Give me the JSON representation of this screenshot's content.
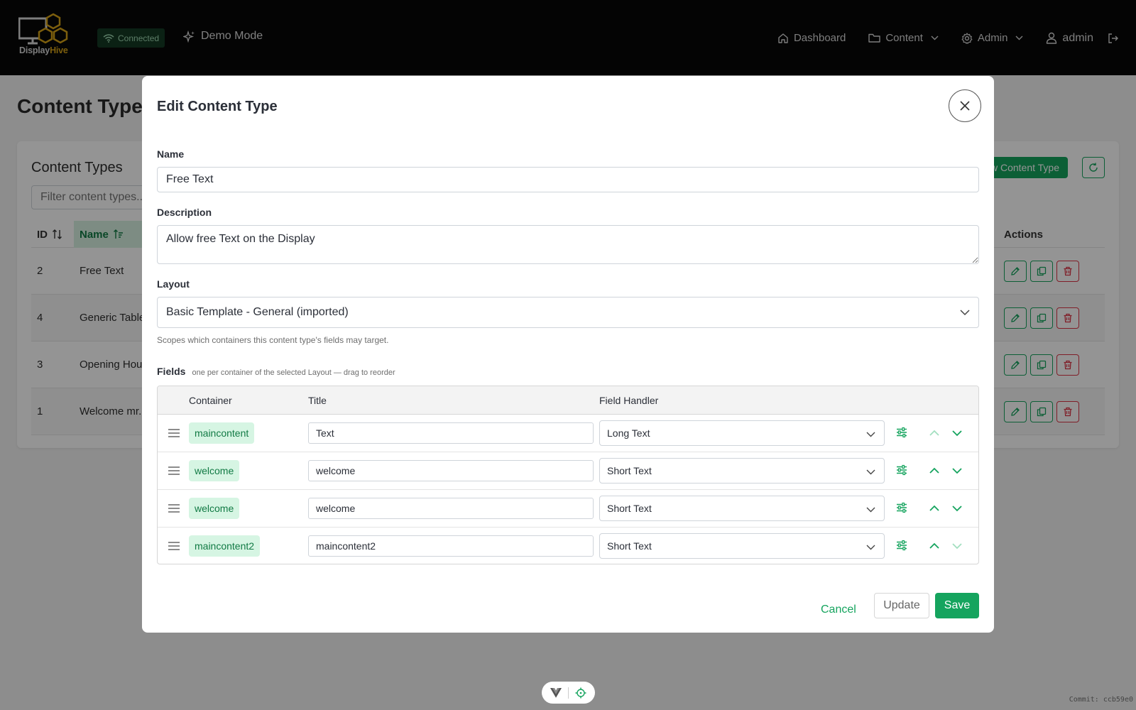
{
  "navbar": {
    "logo_text_1": "Display",
    "logo_text_2": "Hive",
    "connection_status": "Connected",
    "demo_mode": "Demo Mode",
    "items": [
      {
        "label": "Dashboard",
        "icon": "home-icon"
      },
      {
        "label": "Content",
        "icon": "folder-icon"
      },
      {
        "label": "Admin",
        "icon": "gear-icon"
      }
    ],
    "user": "admin"
  },
  "page": {
    "title": "Content Types",
    "card_title": "Content Types",
    "filter_placeholder": "Filter content types...",
    "new_button": "New Content Type",
    "table": {
      "headers": {
        "id": "ID",
        "name": "Name",
        "actions": "Actions"
      },
      "rows": [
        {
          "id": "2",
          "name": "Free Text"
        },
        {
          "id": "4",
          "name": "Generic Table"
        },
        {
          "id": "3",
          "name": "Opening Hours"
        },
        {
          "id": "1",
          "name": "Welcome mr."
        }
      ]
    }
  },
  "modal": {
    "title": "Edit Content Type",
    "name_label": "Name",
    "name_value": "Free Text",
    "description_label": "Description",
    "description_value": "Allow free Text on the Display",
    "layout_label": "Layout",
    "layout_value": "Basic Template - General (imported)",
    "layout_hint": "Scopes which containers this content type's fields may target.",
    "fields_label": "Fields",
    "fields_hint": "one per container of the selected Layout — drag to reorder",
    "fields_headers": {
      "container": "Container",
      "title": "Title",
      "handler": "Field Handler"
    },
    "fields": [
      {
        "container": "maincontent",
        "title": "Text",
        "handler": "Long Text"
      },
      {
        "container": "welcome",
        "title": "welcome",
        "handler": "Short Text"
      },
      {
        "container": "welcome",
        "title": "welcome",
        "handler": "Short Text"
      },
      {
        "container": "maincontent2",
        "title": "maincontent2",
        "handler": "Short Text"
      }
    ],
    "buttons": {
      "cancel": "Cancel",
      "update": "Update",
      "save": "Save"
    }
  },
  "commit": "Commit: ccb59e0",
  "colors": {
    "accent": "#15a45e",
    "danger": "#dc3545",
    "navbar": "#080808",
    "logo_gold": "#d6a317"
  }
}
